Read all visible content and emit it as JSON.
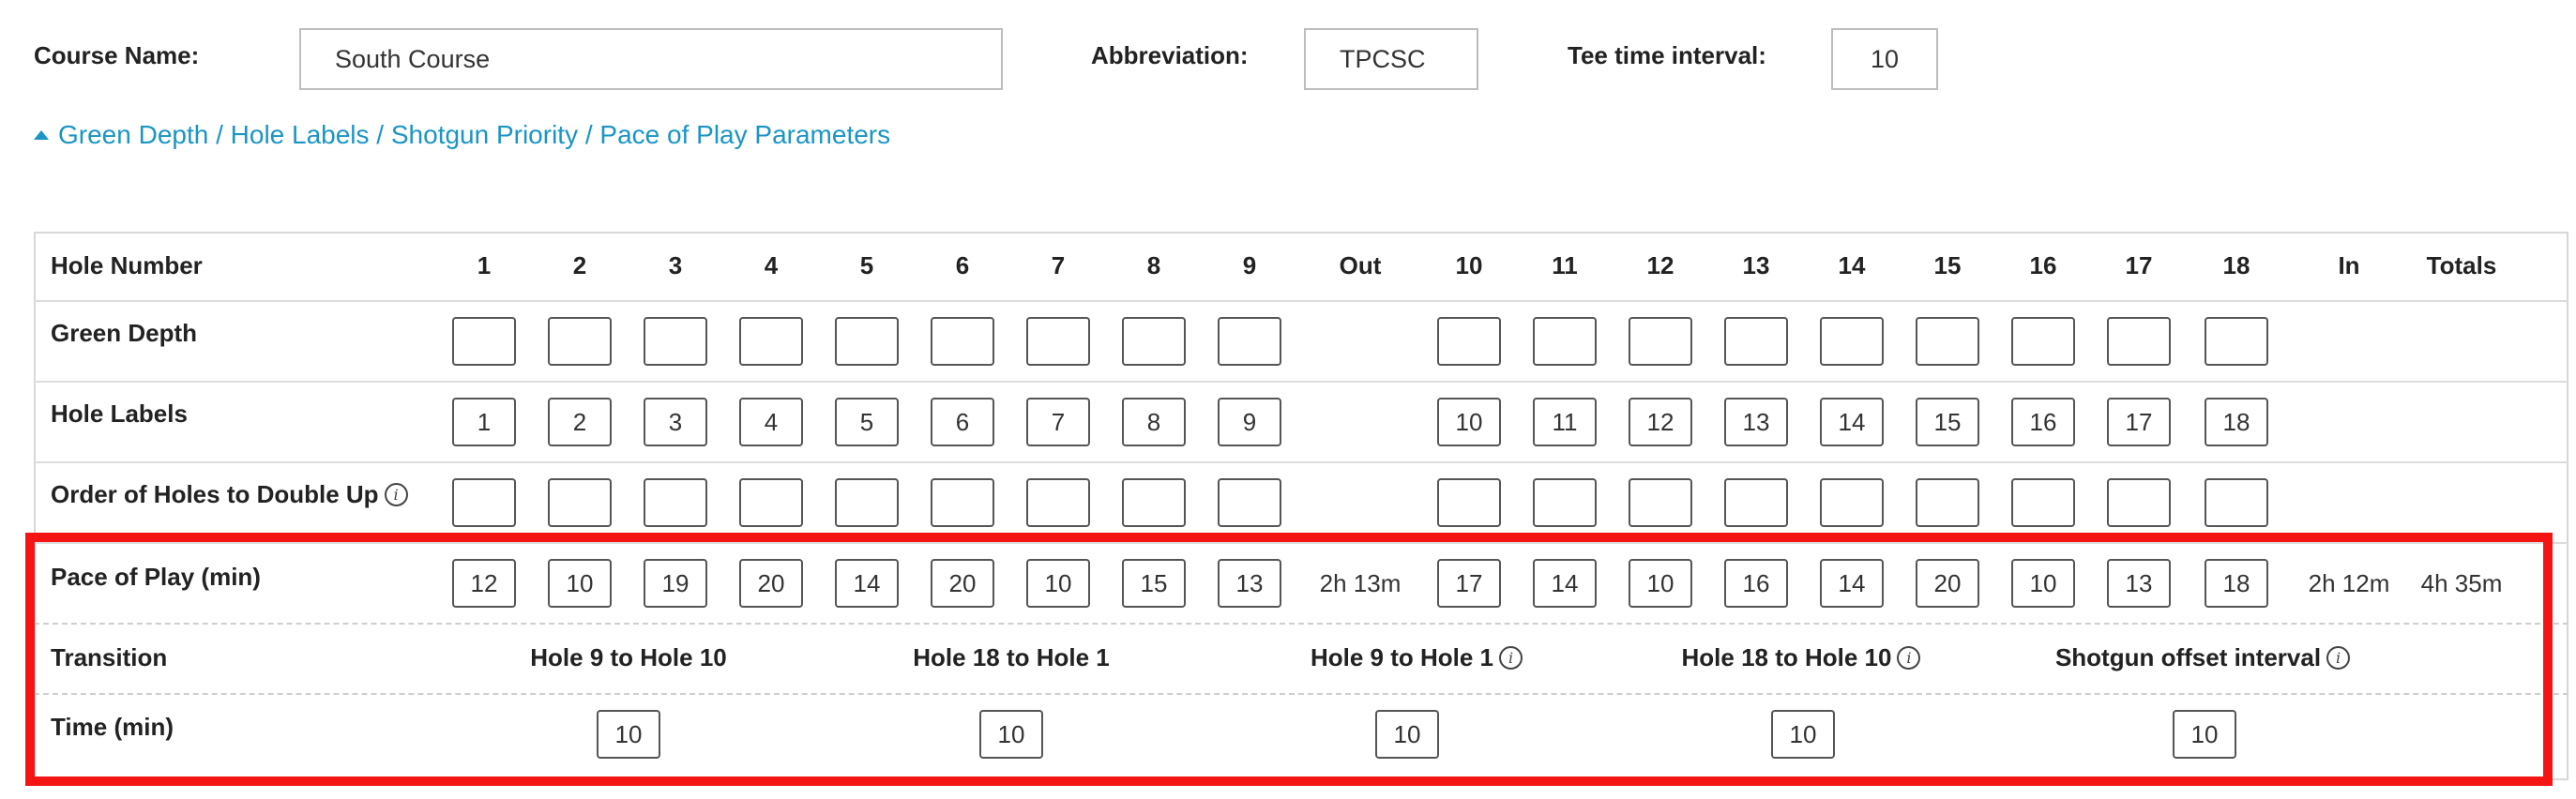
{
  "course": {
    "name_label": "Course Name:",
    "name_value": "South Course",
    "abbr_label": "Abbreviation:",
    "abbr_value": "TPCSC",
    "interval_label": "Tee time interval:",
    "interval_value": "10"
  },
  "expander": {
    "label": "Green Depth / Hole Labels / Shotgun Priority / Pace of Play Parameters",
    "icon": "caret-up-icon"
  },
  "table": {
    "header_label": "Hole Number",
    "columns": [
      "1",
      "2",
      "3",
      "4",
      "5",
      "6",
      "7",
      "8",
      "9",
      "Out",
      "10",
      "11",
      "12",
      "13",
      "14",
      "15",
      "16",
      "17",
      "18",
      "In",
      "Totals"
    ],
    "rows": {
      "green_depth": {
        "label": "Green Depth",
        "values": [
          "",
          "",
          "",
          "",
          "",
          "",
          "",
          "",
          "",
          "",
          "",
          "",
          "",
          "",
          "",
          "",
          "",
          ""
        ]
      },
      "hole_labels": {
        "label": "Hole Labels",
        "values": [
          "1",
          "2",
          "3",
          "4",
          "5",
          "6",
          "7",
          "8",
          "9",
          "10",
          "11",
          "12",
          "13",
          "14",
          "15",
          "16",
          "17",
          "18"
        ]
      },
      "double_up": {
        "label": "Order of Holes to Double Up",
        "values": [
          "",
          "",
          "",
          "",
          "",
          "",
          "",
          "",
          "",
          "",
          "",
          "",
          "",
          "",
          "",
          "",
          "",
          ""
        ]
      },
      "pace": {
        "label": "Pace of Play (min)",
        "values": [
          "12",
          "10",
          "19",
          "20",
          "14",
          "20",
          "10",
          "15",
          "13",
          "17",
          "14",
          "10",
          "16",
          "14",
          "20",
          "10",
          "13",
          "18"
        ],
        "out": "2h 13m",
        "in": "2h 12m",
        "total": "4h 35m"
      }
    }
  },
  "transition": {
    "label": "Transition",
    "time_label": "Time (min)",
    "items": [
      {
        "label": "Hole 9 to Hole 10",
        "value": "10"
      },
      {
        "label": "Hole 18 to Hole 1",
        "value": "10"
      },
      {
        "label": "Hole 9 to Hole 1",
        "value": "10"
      },
      {
        "label": "Hole 18 to Hole 10",
        "value": "10"
      },
      {
        "label": "Shotgun offset interval",
        "value": "10"
      }
    ]
  },
  "info_glyph": "i",
  "colors": {
    "link": "#1a95c4",
    "highlight": "#f41414"
  }
}
